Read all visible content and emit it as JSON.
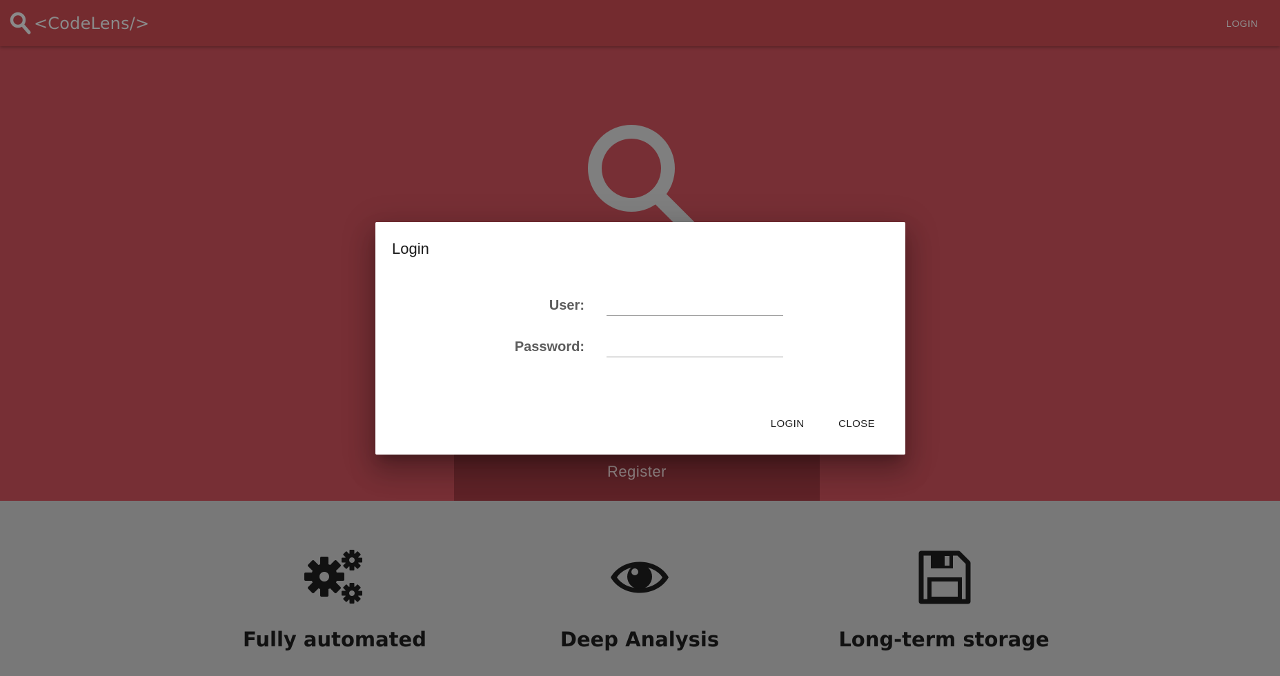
{
  "brand": {
    "name": "<CodeLens/>",
    "icon": "search-icon"
  },
  "nav": {
    "login_label": "LOGIN"
  },
  "hero": {
    "icon": "search-icon",
    "register_label": "Register"
  },
  "features": [
    {
      "icon": "gears-icon",
      "title": "Fully automated"
    },
    {
      "icon": "eye-icon",
      "title": "Deep Analysis"
    },
    {
      "icon": "floppy-disk-icon",
      "title": "Long-term storage"
    }
  ],
  "modal": {
    "title": "Login",
    "user_label": "User:",
    "user_value": "",
    "password_label": "Password:",
    "password_value": "",
    "login_label": "LOGIN",
    "close_label": "CLOSE"
  },
  "colors": {
    "navbar": "#742b2f",
    "hero": "#772f35",
    "features_bg": "#787878",
    "modal_bg": "#ffffff"
  }
}
